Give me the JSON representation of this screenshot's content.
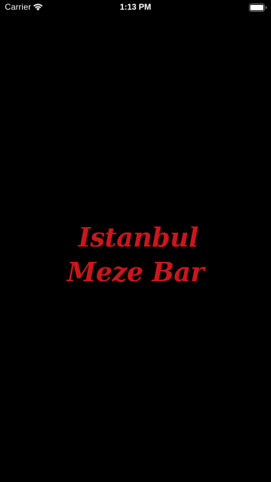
{
  "status_bar": {
    "carrier": "Carrier",
    "time": "1:13 PM",
    "wifi_icon": "wifi-icon",
    "battery_icon": "battery-icon"
  },
  "logo": {
    "line1": "Istanbul",
    "line2": "Meze Bar",
    "color": "#c8171d"
  },
  "background_color": "#000000"
}
